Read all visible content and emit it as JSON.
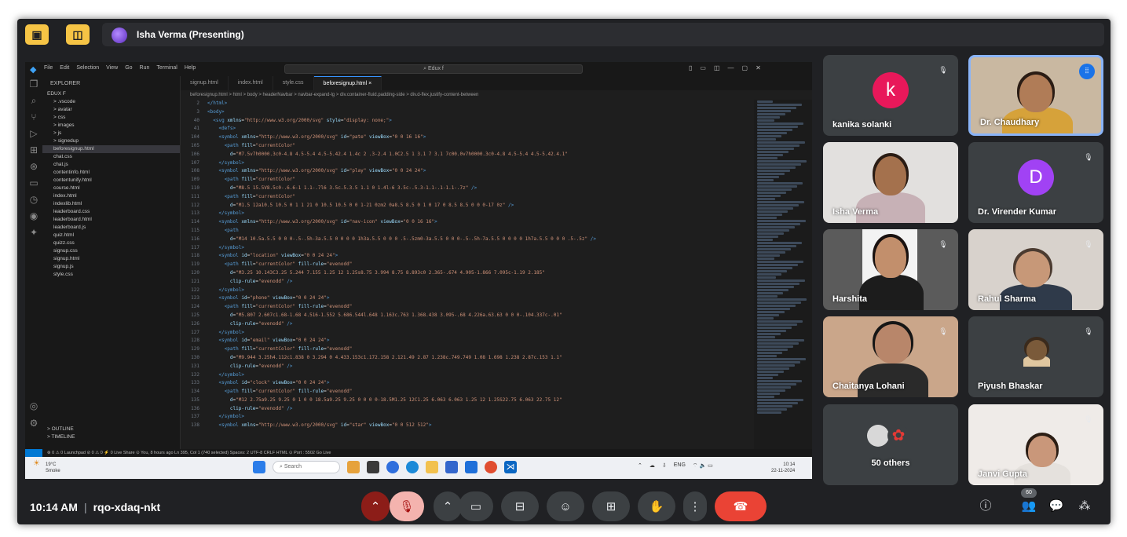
{
  "top_bar": {
    "presenter_name": "Isha Verma (Presenting)",
    "buttons": [
      {
        "name": "screen-share-icon",
        "glyph": "▣"
      },
      {
        "name": "layout-icon",
        "glyph": "◫"
      }
    ]
  },
  "shared_screen": {
    "vscode": {
      "menus": [
        "File",
        "Edit",
        "Selection",
        "View",
        "Go",
        "Run",
        "Terminal",
        "Help"
      ],
      "search": "⌕ Edux f",
      "explorer_title": "EXPLORER",
      "project_root": "EDUX F",
      "files": [
        {
          "label": "> .vscode",
          "indent": 1
        },
        {
          "label": "> avatar",
          "indent": 1
        },
        {
          "label": "> css",
          "indent": 1
        },
        {
          "label": "> images",
          "indent": 1
        },
        {
          "label": "> js",
          "indent": 1
        },
        {
          "label": "> signedup",
          "indent": 1
        },
        {
          "label": "beforesignup.html",
          "indent": 1,
          "selected": true
        },
        {
          "label": "chat.css",
          "indent": 1
        },
        {
          "label": "chat.js",
          "indent": 1
        },
        {
          "label": "contentinfo.html",
          "indent": 1
        },
        {
          "label": "contentunify.html",
          "indent": 1
        },
        {
          "label": "course.html",
          "indent": 1
        },
        {
          "label": "index.html",
          "indent": 1
        },
        {
          "label": "indexlib.html",
          "indent": 1
        },
        {
          "label": "leaderboard.css",
          "indent": 1
        },
        {
          "label": "leaderboard.html",
          "indent": 1
        },
        {
          "label": "leaderboard.js",
          "indent": 1
        },
        {
          "label": "quiz.html",
          "indent": 1
        },
        {
          "label": "quizz.css",
          "indent": 1
        },
        {
          "label": "signup.css",
          "indent": 1
        },
        {
          "label": "signup.html",
          "indent": 1
        },
        {
          "label": "signup.js",
          "indent": 1
        },
        {
          "label": "style.css",
          "indent": 1
        }
      ],
      "explorer_footer": [
        "> OUTLINE",
        "> TIMELINE"
      ],
      "tabs": [
        {
          "label": "signup.html",
          "active": false
        },
        {
          "label": "index.html",
          "active": false
        },
        {
          "label": "style.css",
          "active": false
        },
        {
          "label": "beforesignup.html ×",
          "active": true
        }
      ],
      "breadcrumb": "beforesignup.html > html > body > headerNavbar > navbar-expand-lg > div.container-fluid.padding-side > div.d-flex.justify-content-between",
      "code_lines": [
        {
          "n": "2",
          "html": "<span class='tg'>&lt;/html&gt;</span>"
        },
        {
          "n": "3",
          "html": "<span class='tg'>&lt;body&gt;</span>"
        },
        {
          "n": "40",
          "html": "  <span class='tg'>&lt;svg</span> <span class='at'>xmlns</span>=<span class='st'>\"http://www.w3.org/2000/svg\"</span> <span class='at'>style</span>=<span class='st'>\"display: none;\"</span><span class='tg'>&gt;</span>"
        },
        {
          "n": "41",
          "html": "    <span class='tg'>&lt;defs&gt;</span>"
        },
        {
          "n": "104",
          "html": "    <span class='tg'>&lt;symbol</span> <span class='at'>xmlns</span>=<span class='st'>\"http://www.w3.org/2000/svg\"</span> <span class='at'>id</span>=<span class='st'>\"pate\"</span> <span class='at'>viewBox</span>=<span class='st'>\"0 0 16 16\"</span><span class='tg'>&gt;</span>"
        },
        {
          "n": "105",
          "html": "      <span class='tg'>&lt;path</span> <span class='at'>fill</span>=<span class='st'>\"currentColor\"</span>"
        },
        {
          "n": "106",
          "html": "        <span class='at'>d</span>=<span class='st'>\"M7.5v7h0000.3c0-4.8 4.5-5.4 4.5-5.42.4 1.4c 2 .3-2.4 1.0C2.5 1 3.1 7 3.1 7c00.0v7h0000.3c0-4.8 4.5-5.4 4.5-5.42.4.1\"</span>"
        },
        {
          "n": "107",
          "html": "    <span class='tg'>&lt;/symbol&gt;</span>"
        },
        {
          "n": "108",
          "html": "    <span class='tg'>&lt;symbol</span> <span class='at'>xmlns</span>=<span class='st'>\"http://www.w3.org/2000/svg\"</span> <span class='at'>id</span>=<span class='st'>\"play\"</span> <span class='at'>viewBox</span>=<span class='st'>\"0 0 24 24\"</span><span class='tg'>&gt;</span>"
        },
        {
          "n": "109",
          "html": "      <span class='tg'>&lt;path</span> <span class='at'>fill</span>=<span class='st'>\"currentColor\"</span>"
        },
        {
          "n": "110",
          "html": "        <span class='at'>d</span>=<span class='st'>\"M8.5 15.5V8.5c0-.6.6-1 1.1-.7l6 3.5c.5.3.5 1.1 0 1.4l-6 3.5c-.5.3-1.1-.1-1.1-.7z\"</span> <span class='tg'>/&gt;</span>"
        },
        {
          "n": "111",
          "html": "      <span class='tg'>&lt;path</span> <span class='at'>fill</span>=<span class='st'>\"currentColor\"</span>"
        },
        {
          "n": "112",
          "html": "        <span class='at'>d</span>=<span class='st'>\"M1.5 12a10.5 10.5 0 1 1 21 0 10.5 10.5 0 0 1-21 0zm2 0a8.5 8.5 0 1 0 17 0 8.5 8.5 0 0 0-17 0z\"</span> <span class='tg'>/&gt;</span>"
        },
        {
          "n": "113",
          "html": "    <span class='tg'>&lt;/symbol&gt;</span>"
        },
        {
          "n": "114",
          "html": "    <span class='tg'>&lt;symbol</span> <span class='at'>xmlns</span>=<span class='st'>\"http://www.w3.org/2000/svg\"</span> <span class='at'>id</span>=<span class='st'>\"nav-icon\"</span> <span class='at'>viewBox</span>=<span class='st'>\"0 0 16 16\"</span><span class='tg'>&gt;</span>"
        },
        {
          "n": "115",
          "html": "      <span class='tg'>&lt;path</span>"
        },
        {
          "n": "116",
          "html": "        <span class='at'>d</span>=<span class='st'>\"M14 10.5a.5.5 0 0 0-.5-.5h-3a.5.5 0 0 0 0 1h3a.5.5 0 0 0 .5-.5zm0-3a.5.5 0 0 0-.5-.5h-7a.5.5 0 0 0 0 1h7a.5.5 0 0 0 .5-.5z\"</span> <span class='tg'>/&gt;</span>"
        },
        {
          "n": "117",
          "html": "    <span class='tg'>&lt;/symbol&gt;</span>"
        },
        {
          "n": "118",
          "html": "    <span class='tg'>&lt;symbol</span> <span class='at'>id</span>=<span class='st'>\"location\"</span> <span class='at'>viewBox</span>=<span class='st'>\"0 0 24 24\"</span><span class='tg'>&gt;</span>"
        },
        {
          "n": "119",
          "html": "      <span class='tg'>&lt;path</span> <span class='at'>fill</span>=<span class='st'>\"currentColor\"</span> <span class='at'>fill-rule</span>=<span class='st'>\"evenodd\"</span>"
        },
        {
          "n": "120",
          "html": "        <span class='at'>d</span>=<span class='st'>\"M3.25 10.143C3.25 5.244 7.155 1.25 12 1.25s8.75 3.994 8.75 8.893c0 2.365-.674 4.905-1.866 7.095c-1.19 2.185\"</span>"
        },
        {
          "n": "121",
          "html": "        <span class='at'>clip-rule</span>=<span class='st'>\"evenodd\"</span> <span class='tg'>/&gt;</span>"
        },
        {
          "n": "122",
          "html": "    <span class='tg'>&lt;/symbol&gt;</span>"
        },
        {
          "n": "123",
          "html": "    <span class='tg'>&lt;symbol</span> <span class='at'>id</span>=<span class='st'>\"phone\"</span> <span class='at'>viewBox</span>=<span class='st'>\"0 0 24 24\"</span><span class='tg'>&gt;</span>"
        },
        {
          "n": "124",
          "html": "      <span class='tg'>&lt;path</span> <span class='at'>fill</span>=<span class='st'>\"currentColor\"</span> <span class='at'>fill-rule</span>=<span class='st'>\"evenodd\"</span>"
        },
        {
          "n": "125",
          "html": "        <span class='at'>d</span>=<span class='st'>\"M5.807 2.607c1.68-1.68 4.516-1.552 5.686.544l.648 1.163c.763 1.368.438 3.095-.68 4.226a.63.63 0 0 0-.104.337c-.01\"</span>"
        },
        {
          "n": "126",
          "html": "        <span class='at'>clip-rule</span>=<span class='st'>\"evenodd\"</span> <span class='tg'>/&gt;</span>"
        },
        {
          "n": "127",
          "html": "    <span class='tg'>&lt;/symbol&gt;</span>"
        },
        {
          "n": "128",
          "html": "    <span class='tg'>&lt;symbol</span> <span class='at'>id</span>=<span class='st'>\"email\"</span> <span class='at'>viewBox</span>=<span class='st'>\"0 0 24 24\"</span><span class='tg'>&gt;</span>"
        },
        {
          "n": "129",
          "html": "      <span class='tg'>&lt;path</span> <span class='at'>fill</span>=<span class='st'>\"currentColor\"</span> <span class='at'>fill-rule</span>=<span class='st'>\"evenodd\"</span>"
        },
        {
          "n": "130",
          "html": "        <span class='at'>d</span>=<span class='st'>\"M9.944 3.25h4.112c1.838 0 3.294 0 4.433.153c1.172.158 2.121.49 2.87 1.238c.749.749 1.08 1.698 1.238 2.87c.153 1.1\"</span>"
        },
        {
          "n": "131",
          "html": "        <span class='at'>clip-rule</span>=<span class='st'>\"evenodd\"</span> <span class='tg'>/&gt;</span>"
        },
        {
          "n": "132",
          "html": "    <span class='tg'>&lt;/symbol&gt;</span>"
        },
        {
          "n": "133",
          "html": "    <span class='tg'>&lt;symbol</span> <span class='at'>id</span>=<span class='st'>\"clock\"</span> <span class='at'>viewBox</span>=<span class='st'>\"0 0 24 24\"</span><span class='tg'>&gt;</span>"
        },
        {
          "n": "134",
          "html": "      <span class='tg'>&lt;path</span> <span class='at'>fill</span>=<span class='st'>\"currentColor\"</span> <span class='at'>fill-rule</span>=<span class='st'>\"evenodd\"</span>"
        },
        {
          "n": "135",
          "html": "        <span class='at'>d</span>=<span class='st'>\"M12 2.75a9.25 9.25 0 1 0 0 18.5a9.25 9.25 0 0 0 0-18.5M1.25 12C1.25 6.063 6.063 1.25 12 1.25S22.75 6.063 22.75 12\"</span>"
        },
        {
          "n": "136",
          "html": "        <span class='at'>clip-rule</span>=<span class='st'>\"evenodd\"</span> <span class='tg'>/&gt;</span>"
        },
        {
          "n": "137",
          "html": "    <span class='tg'>&lt;/symbol&gt;</span>"
        },
        {
          "n": "138",
          "html": "    <span class='tg'>&lt;symbol</span> <span class='at'>xmlns</span>=<span class='st'>\"http://www.w3.org/2000/svg\"</span> <span class='at'>id</span>=<span class='st'>\"star\"</span> <span class='at'>viewBox</span>=<span class='st'>\"0 0 512 512\"</span><span class='tg'>&gt;</span>"
        }
      ],
      "statusbar": "⊗ 0 ⚠ 0   Launchpad   ⊘ 0 ⚠ 0   ⚡ 0   Live Share        ⊙ You, 8 hours ago   Ln 395, Col 1 (740 selected)   Spaces: 2   UTF-8   CRLF   HTML   ⊙ Port : 5502   Go Live"
    },
    "taskbar": {
      "weather_temp": "19°C",
      "weather_desc": "Smoke",
      "search": "⌕ Search",
      "tray": [
        "⌃",
        "☁",
        "⇩",
        "ENG",
        "⌔ 🔈 ▭"
      ],
      "lang": "IN",
      "time": "10:14",
      "date": "22-11-2024"
    }
  },
  "participants": [
    {
      "name": "kanika solanki",
      "type": "avatar",
      "letter": "k",
      "color": "#e8185a",
      "muted": true
    },
    {
      "name": "Dr. Chaudhary",
      "type": "video",
      "speaking": true
    },
    {
      "name": "Isha Verma",
      "type": "video",
      "muted": false
    },
    {
      "name": "Dr. Virender Kumar",
      "type": "avatar",
      "letter": "D",
      "color": "#a142f4",
      "muted": true
    },
    {
      "name": "Harshita",
      "type": "video",
      "muted": true
    },
    {
      "name": "Rahul Sharma",
      "type": "video",
      "muted": true
    },
    {
      "name": "Chaitanya Lohani",
      "type": "video",
      "muted": true
    },
    {
      "name": "Piyush Bhaskar",
      "type": "video",
      "muted": true
    },
    {
      "name": "50 others",
      "type": "others"
    },
    {
      "name": "Janvi Gupta",
      "type": "video",
      "muted": true
    }
  ],
  "bottom_bar": {
    "time": "10:14 AM",
    "separator": "|",
    "meeting_code": "rqo-xdaq-nkt",
    "controls": [
      {
        "name": "mic-options-button",
        "glyph": "⌃"
      },
      {
        "name": "mic-muted-button",
        "glyph": "🎙"
      },
      {
        "name": "camera-options-button",
        "glyph": "⌃"
      },
      {
        "name": "camera-button",
        "glyph": "▭"
      },
      {
        "name": "captions-button",
        "glyph": "⊟"
      },
      {
        "name": "emoji-button",
        "glyph": "☺"
      },
      {
        "name": "present-button",
        "glyph": "⊞"
      },
      {
        "name": "raise-hand-button",
        "glyph": "✋"
      },
      {
        "name": "more-options-button",
        "glyph": "⋮"
      },
      {
        "name": "leave-call-button",
        "glyph": "☎"
      }
    ],
    "right_controls": [
      {
        "name": "meeting-info-button",
        "glyph": "ⓘ"
      },
      {
        "name": "people-button",
        "glyph": "👥"
      },
      {
        "name": "chat-button",
        "glyph": "💬"
      },
      {
        "name": "activities-button",
        "glyph": "⁂"
      }
    ],
    "people_count": "60"
  }
}
